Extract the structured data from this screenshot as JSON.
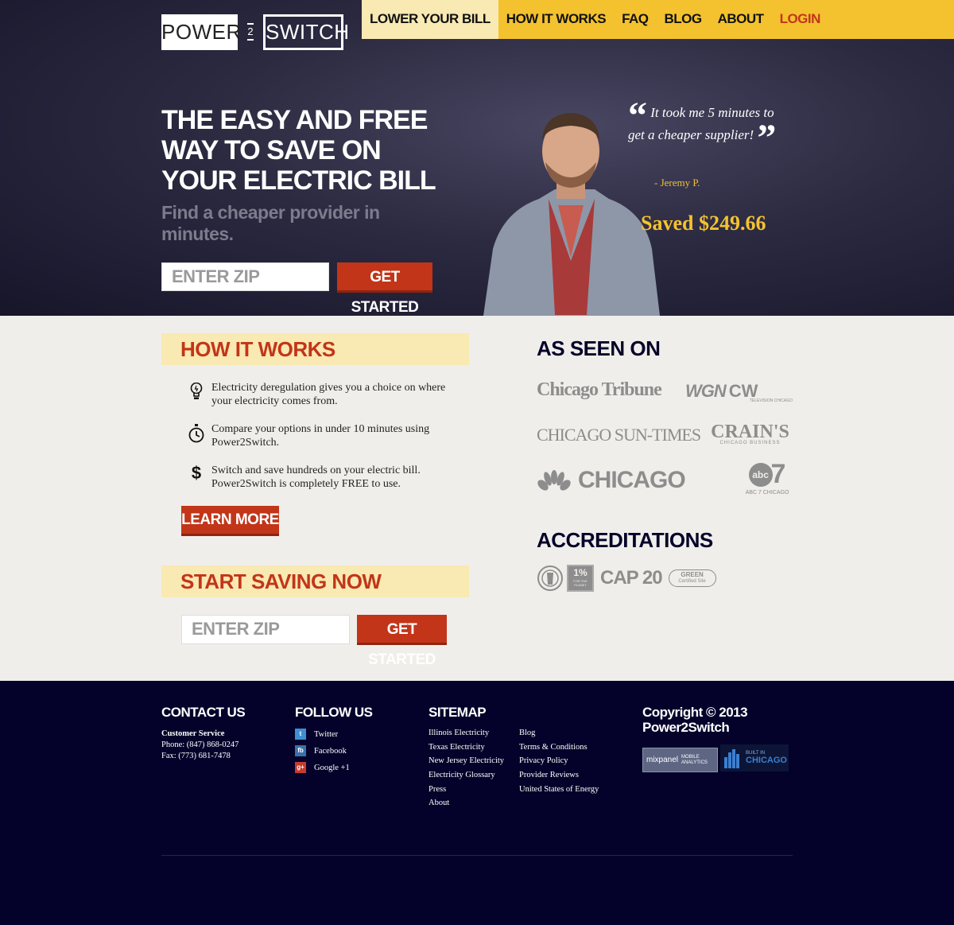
{
  "logo": {
    "left": "POWER",
    "middle": "2",
    "right": "SWITCH"
  },
  "nav": {
    "items": [
      {
        "label": "LOWER YOUR BILL"
      },
      {
        "label": "HOW IT WORKS"
      },
      {
        "label": "FAQ"
      },
      {
        "label": "BLOG"
      },
      {
        "label": "ABOUT"
      },
      {
        "label": "LOGIN"
      }
    ]
  },
  "hero": {
    "headline": "THE EASY AND FREE WAY TO SAVE ON YOUR ELECTRIC BILL",
    "subhead": "Find a cheaper provider in minutes.",
    "zip_placeholder": "ENTER ZIP",
    "cta": "GET STARTED",
    "quote": "It took me 5 minutes to get a cheaper supplier!",
    "quote_author": "- Jeremy P.",
    "saved": "Saved $249.66"
  },
  "how_it_works": {
    "title": "HOW IT WORKS",
    "steps": [
      {
        "icon": "lightbulb-icon",
        "text": "Electricity deregulation gives you a choice on where your electricity comes from."
      },
      {
        "icon": "stopwatch-icon",
        "text": "Compare your options in under 10 minutes using Power2Switch."
      },
      {
        "icon": "dollar-icon",
        "text": "Switch and save hundreds on your electric bill. Power2Switch is completely FREE to use."
      }
    ],
    "learn_more": "LEARN MORE"
  },
  "start_saving": {
    "title": "START SAVING NOW",
    "zip_placeholder": "ENTER ZIP",
    "cta": "GET STARTED"
  },
  "as_seen_on": {
    "title": "AS SEEN ON",
    "media": [
      "Chicago Tribune",
      "WGN",
      "CW",
      "TELEVISION CHICAGO",
      "CHICAGO SUN-TIMES",
      "CRAIN'S",
      "CHICAGO BUSINESS",
      "CHICAGO",
      "abc",
      "7",
      "ABC 7 CHICAGO"
    ]
  },
  "accreditations": {
    "title": "ACCREDITATIONS",
    "badges": [
      "1%",
      "FOR THE PLANET",
      "CAP 20",
      "GREEN",
      "Certified Site"
    ]
  },
  "footer": {
    "contact": {
      "title": "CONTACT US",
      "label": "Customer Service",
      "phone": "Phone: (847) 868-0247",
      "fax": "Fax: (773) 681-7478"
    },
    "follow": {
      "title": "FOLLOW US",
      "items": [
        "Twitter",
        "Facebook",
        "Google +1"
      ]
    },
    "sitemap": {
      "title": "SITEMAP",
      "col1": [
        "Illinois Electricity",
        "Texas Electricity",
        "New Jersey Electricity",
        "Electricity Glossary",
        "Press",
        "About"
      ],
      "col2": [
        "Blog",
        "Terms & Conditions",
        "Privacy Policy",
        "Provider Reviews",
        "United States of Energy"
      ]
    },
    "copyright": "Copyright © 2013 Power2Switch",
    "badges": {
      "mixpanel": "mixpanel",
      "mixpanel_sub1": "MOBILE",
      "mixpanel_sub2": "ANALYTICS",
      "built_in": "BUILT IN",
      "chicago": "CHICAGO"
    }
  },
  "colors": {
    "accent_red": "#c23519",
    "accent_yellow": "#f4c22e",
    "navy": "#04022a",
    "cream_band": "#f9e9b2"
  }
}
